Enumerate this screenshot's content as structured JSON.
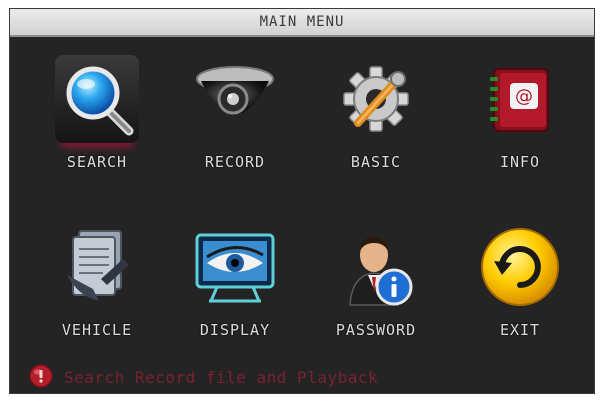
{
  "window": {
    "title": "MAIN MENU"
  },
  "menu": {
    "items": [
      {
        "id": "search",
        "label": "SEARCH",
        "icon": "magnifier-icon",
        "selected": true
      },
      {
        "id": "record",
        "label": "RECORD",
        "icon": "dome-camera-icon"
      },
      {
        "id": "basic",
        "label": "BASIC",
        "icon": "gear-wrench-icon"
      },
      {
        "id": "info",
        "label": "INFO",
        "icon": "address-book-icon"
      },
      {
        "id": "vehicle",
        "label": "VEHICLE",
        "icon": "documents-icon"
      },
      {
        "id": "display",
        "label": "DISPLAY",
        "icon": "monitor-eye-icon"
      },
      {
        "id": "password",
        "label": "PASSWORD",
        "icon": "user-info-icon"
      },
      {
        "id": "exit",
        "label": "EXIT",
        "icon": "refresh-exit-icon"
      }
    ]
  },
  "status": {
    "hint": "Search Record file and Playback",
    "icon": "alert-bulb-icon"
  },
  "colors": {
    "background": "#242424",
    "title_bar": "#dcdcdc",
    "label": "#dcdcdc",
    "hint": "#7a2230",
    "highlight": "#8b1a3a"
  }
}
